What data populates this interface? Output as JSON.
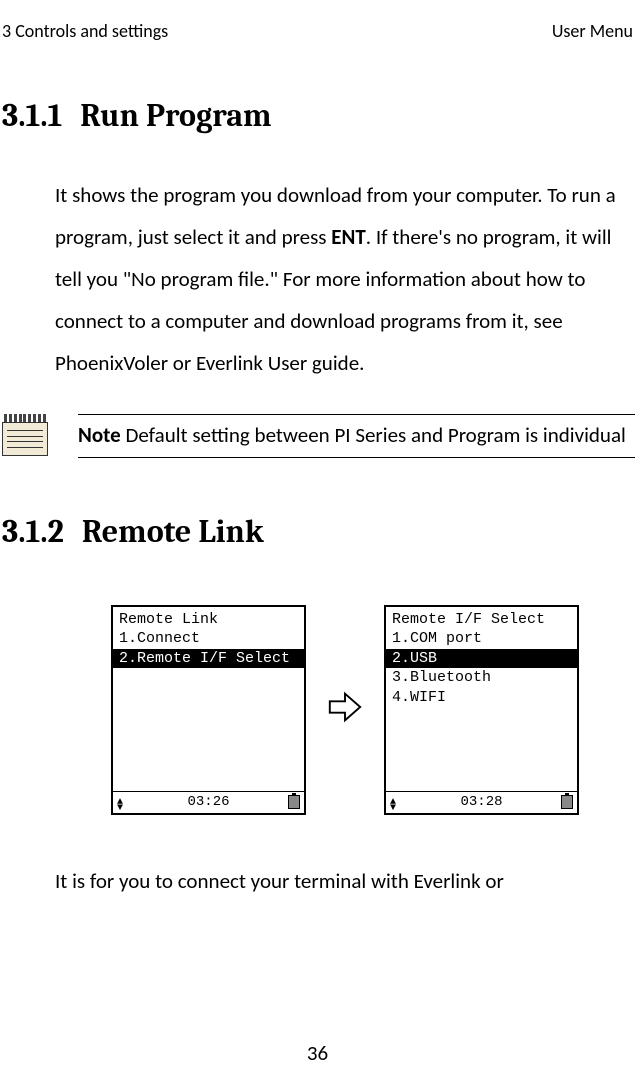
{
  "header": {
    "left": "3 Controls and settings",
    "right": "User Menu"
  },
  "section1": {
    "number": "3.1.1",
    "title": "Run Program",
    "body_pre": "It shows the program you download from your computer. To run a program, just select it and press ",
    "body_bold": "ENT",
    "body_post": ". If there's no program, it will tell you \"No program file.\" For more information about how to connect to a computer and download programs from it, see PhoenixVoler or Everlink User guide."
  },
  "note": {
    "label": "Note",
    "text": "    Default setting between PI Series and Program is individual"
  },
  "section2": {
    "number": "3.1.2",
    "title": "Remote Link"
  },
  "screen1": {
    "title": "  Remote Link",
    "row1": "1.Connect",
    "row2": "2.Remote I/F Select",
    "time": "03:26"
  },
  "screen2": {
    "title": " Remote I/F Select",
    "row1": "1.COM port",
    "row2": "2.USB",
    "row3": "3.Bluetooth",
    "row4": "4.WIFI",
    "time": "03:28"
  },
  "body2": "It is for you to connect your terminal with Everlink or",
  "pageNumber": "36"
}
